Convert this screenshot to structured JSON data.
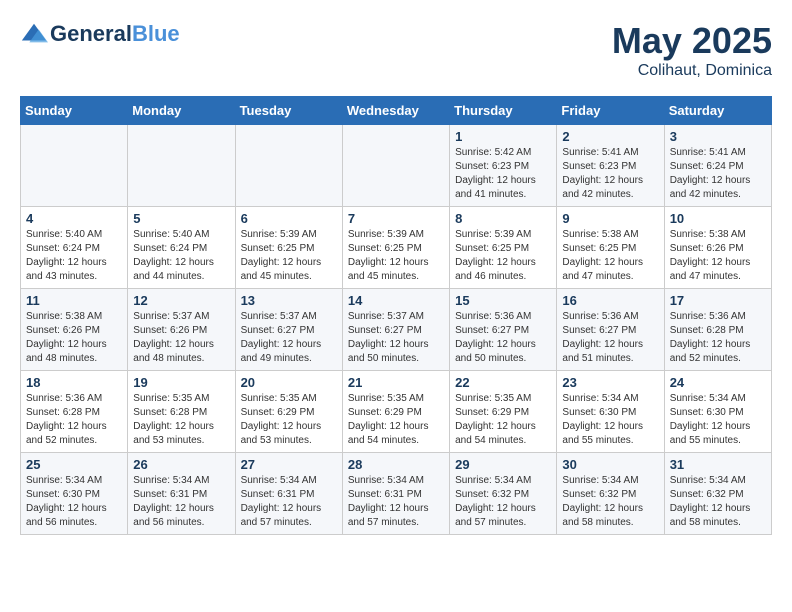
{
  "header": {
    "logo_line1": "General",
    "logo_line2": "Blue",
    "month": "May 2025",
    "location": "Colihaut, Dominica"
  },
  "columns": [
    "Sunday",
    "Monday",
    "Tuesday",
    "Wednesday",
    "Thursday",
    "Friday",
    "Saturday"
  ],
  "weeks": [
    [
      {
        "day": "",
        "info": ""
      },
      {
        "day": "",
        "info": ""
      },
      {
        "day": "",
        "info": ""
      },
      {
        "day": "",
        "info": ""
      },
      {
        "day": "1",
        "info": "Sunrise: 5:42 AM\nSunset: 6:23 PM\nDaylight: 12 hours\nand 41 minutes."
      },
      {
        "day": "2",
        "info": "Sunrise: 5:41 AM\nSunset: 6:23 PM\nDaylight: 12 hours\nand 42 minutes."
      },
      {
        "day": "3",
        "info": "Sunrise: 5:41 AM\nSunset: 6:24 PM\nDaylight: 12 hours\nand 42 minutes."
      }
    ],
    [
      {
        "day": "4",
        "info": "Sunrise: 5:40 AM\nSunset: 6:24 PM\nDaylight: 12 hours\nand 43 minutes."
      },
      {
        "day": "5",
        "info": "Sunrise: 5:40 AM\nSunset: 6:24 PM\nDaylight: 12 hours\nand 44 minutes."
      },
      {
        "day": "6",
        "info": "Sunrise: 5:39 AM\nSunset: 6:25 PM\nDaylight: 12 hours\nand 45 minutes."
      },
      {
        "day": "7",
        "info": "Sunrise: 5:39 AM\nSunset: 6:25 PM\nDaylight: 12 hours\nand 45 minutes."
      },
      {
        "day": "8",
        "info": "Sunrise: 5:39 AM\nSunset: 6:25 PM\nDaylight: 12 hours\nand 46 minutes."
      },
      {
        "day": "9",
        "info": "Sunrise: 5:38 AM\nSunset: 6:25 PM\nDaylight: 12 hours\nand 47 minutes."
      },
      {
        "day": "10",
        "info": "Sunrise: 5:38 AM\nSunset: 6:26 PM\nDaylight: 12 hours\nand 47 minutes."
      }
    ],
    [
      {
        "day": "11",
        "info": "Sunrise: 5:38 AM\nSunset: 6:26 PM\nDaylight: 12 hours\nand 48 minutes."
      },
      {
        "day": "12",
        "info": "Sunrise: 5:37 AM\nSunset: 6:26 PM\nDaylight: 12 hours\nand 48 minutes."
      },
      {
        "day": "13",
        "info": "Sunrise: 5:37 AM\nSunset: 6:27 PM\nDaylight: 12 hours\nand 49 minutes."
      },
      {
        "day": "14",
        "info": "Sunrise: 5:37 AM\nSunset: 6:27 PM\nDaylight: 12 hours\nand 50 minutes."
      },
      {
        "day": "15",
        "info": "Sunrise: 5:36 AM\nSunset: 6:27 PM\nDaylight: 12 hours\nand 50 minutes."
      },
      {
        "day": "16",
        "info": "Sunrise: 5:36 AM\nSunset: 6:27 PM\nDaylight: 12 hours\nand 51 minutes."
      },
      {
        "day": "17",
        "info": "Sunrise: 5:36 AM\nSunset: 6:28 PM\nDaylight: 12 hours\nand 52 minutes."
      }
    ],
    [
      {
        "day": "18",
        "info": "Sunrise: 5:36 AM\nSunset: 6:28 PM\nDaylight: 12 hours\nand 52 minutes."
      },
      {
        "day": "19",
        "info": "Sunrise: 5:35 AM\nSunset: 6:28 PM\nDaylight: 12 hours\nand 53 minutes."
      },
      {
        "day": "20",
        "info": "Sunrise: 5:35 AM\nSunset: 6:29 PM\nDaylight: 12 hours\nand 53 minutes."
      },
      {
        "day": "21",
        "info": "Sunrise: 5:35 AM\nSunset: 6:29 PM\nDaylight: 12 hours\nand 54 minutes."
      },
      {
        "day": "22",
        "info": "Sunrise: 5:35 AM\nSunset: 6:29 PM\nDaylight: 12 hours\nand 54 minutes."
      },
      {
        "day": "23",
        "info": "Sunrise: 5:34 AM\nSunset: 6:30 PM\nDaylight: 12 hours\nand 55 minutes."
      },
      {
        "day": "24",
        "info": "Sunrise: 5:34 AM\nSunset: 6:30 PM\nDaylight: 12 hours\nand 55 minutes."
      }
    ],
    [
      {
        "day": "25",
        "info": "Sunrise: 5:34 AM\nSunset: 6:30 PM\nDaylight: 12 hours\nand 56 minutes."
      },
      {
        "day": "26",
        "info": "Sunrise: 5:34 AM\nSunset: 6:31 PM\nDaylight: 12 hours\nand 56 minutes."
      },
      {
        "day": "27",
        "info": "Sunrise: 5:34 AM\nSunset: 6:31 PM\nDaylight: 12 hours\nand 57 minutes."
      },
      {
        "day": "28",
        "info": "Sunrise: 5:34 AM\nSunset: 6:31 PM\nDaylight: 12 hours\nand 57 minutes."
      },
      {
        "day": "29",
        "info": "Sunrise: 5:34 AM\nSunset: 6:32 PM\nDaylight: 12 hours\nand 57 minutes."
      },
      {
        "day": "30",
        "info": "Sunrise: 5:34 AM\nSunset: 6:32 PM\nDaylight: 12 hours\nand 58 minutes."
      },
      {
        "day": "31",
        "info": "Sunrise: 5:34 AM\nSunset: 6:32 PM\nDaylight: 12 hours\nand 58 minutes."
      }
    ]
  ]
}
